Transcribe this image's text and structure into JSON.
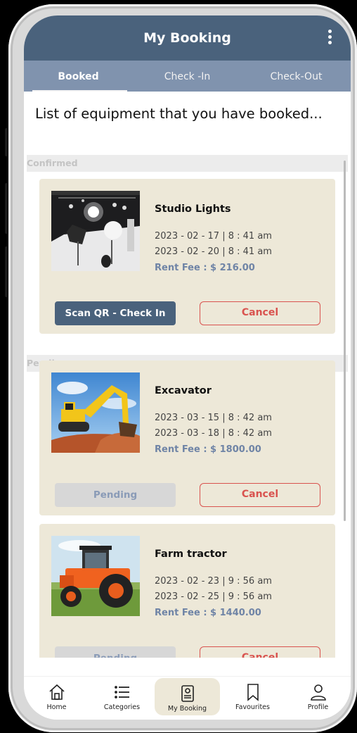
{
  "header": {
    "title": "My Booking"
  },
  "tabs": [
    {
      "label": "Booked",
      "active": true
    },
    {
      "label": "Check -In",
      "active": false
    },
    {
      "label": "Check-Out",
      "active": false
    }
  ],
  "subtitle": "List of equipment that you have booked...",
  "sections": {
    "confirmed": "Confirmed",
    "pending": "Pending"
  },
  "bookings": [
    {
      "name": "Studio Lights",
      "start": "2023 - 02 - 17 | 8 : 41 am",
      "end": "2023 - 02 - 20 | 8 : 41 am",
      "fee": "Rent Fee : $ 216.00",
      "primary_label": "Scan QR - Check In",
      "cancel_label": "Cancel"
    },
    {
      "name": "Excavator",
      "start": "2023 - 03 - 15 | 8 : 42 am",
      "end": "2023 - 03 - 18 | 8 : 42 am",
      "fee": "Rent Fee : $ 1800.00",
      "primary_label": "Pending",
      "cancel_label": "Cancel"
    },
    {
      "name": "Farm tractor",
      "start": "2023 - 02 - 23 | 9 : 56 am",
      "end": "2023 - 02 - 25 | 9 : 56 am",
      "fee": "Rent Fee : $ 1440.00",
      "primary_label": "Pending",
      "cancel_label": "Cancel"
    }
  ],
  "nav": [
    {
      "label": "Home",
      "icon": "home-icon"
    },
    {
      "label": "Categories",
      "icon": "list-icon"
    },
    {
      "label": "My Booking",
      "icon": "booking-icon",
      "active": true
    },
    {
      "label": "Favourites",
      "icon": "bookmark-icon"
    },
    {
      "label": "Profile",
      "icon": "user-icon"
    }
  ],
  "colors": {
    "primary": "#4a627c",
    "tab_bar": "#8093ae",
    "card": "#ede8d8",
    "cancel": "#d9534f",
    "fee": "#6f84a6"
  }
}
